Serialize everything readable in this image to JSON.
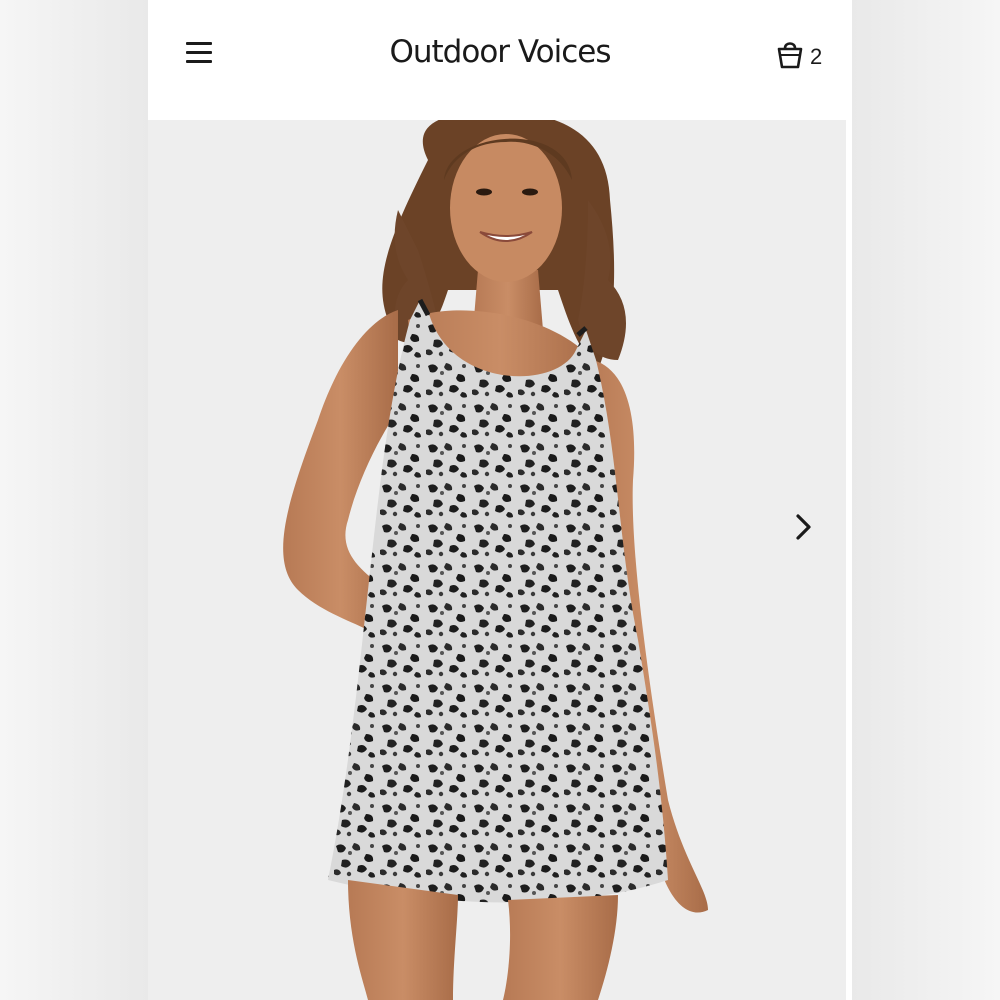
{
  "header": {
    "brand": "Outdoor Voices",
    "cart_count": "2"
  },
  "product_image": {
    "description_icon": "model-wearing-leopard-print-dress-photo"
  },
  "carousel": {
    "next_icon": "chevron-right-icon"
  },
  "colors": {
    "background": "#ffffff",
    "text": "#1a1a1a",
    "hero_background": "#eeeeee"
  }
}
